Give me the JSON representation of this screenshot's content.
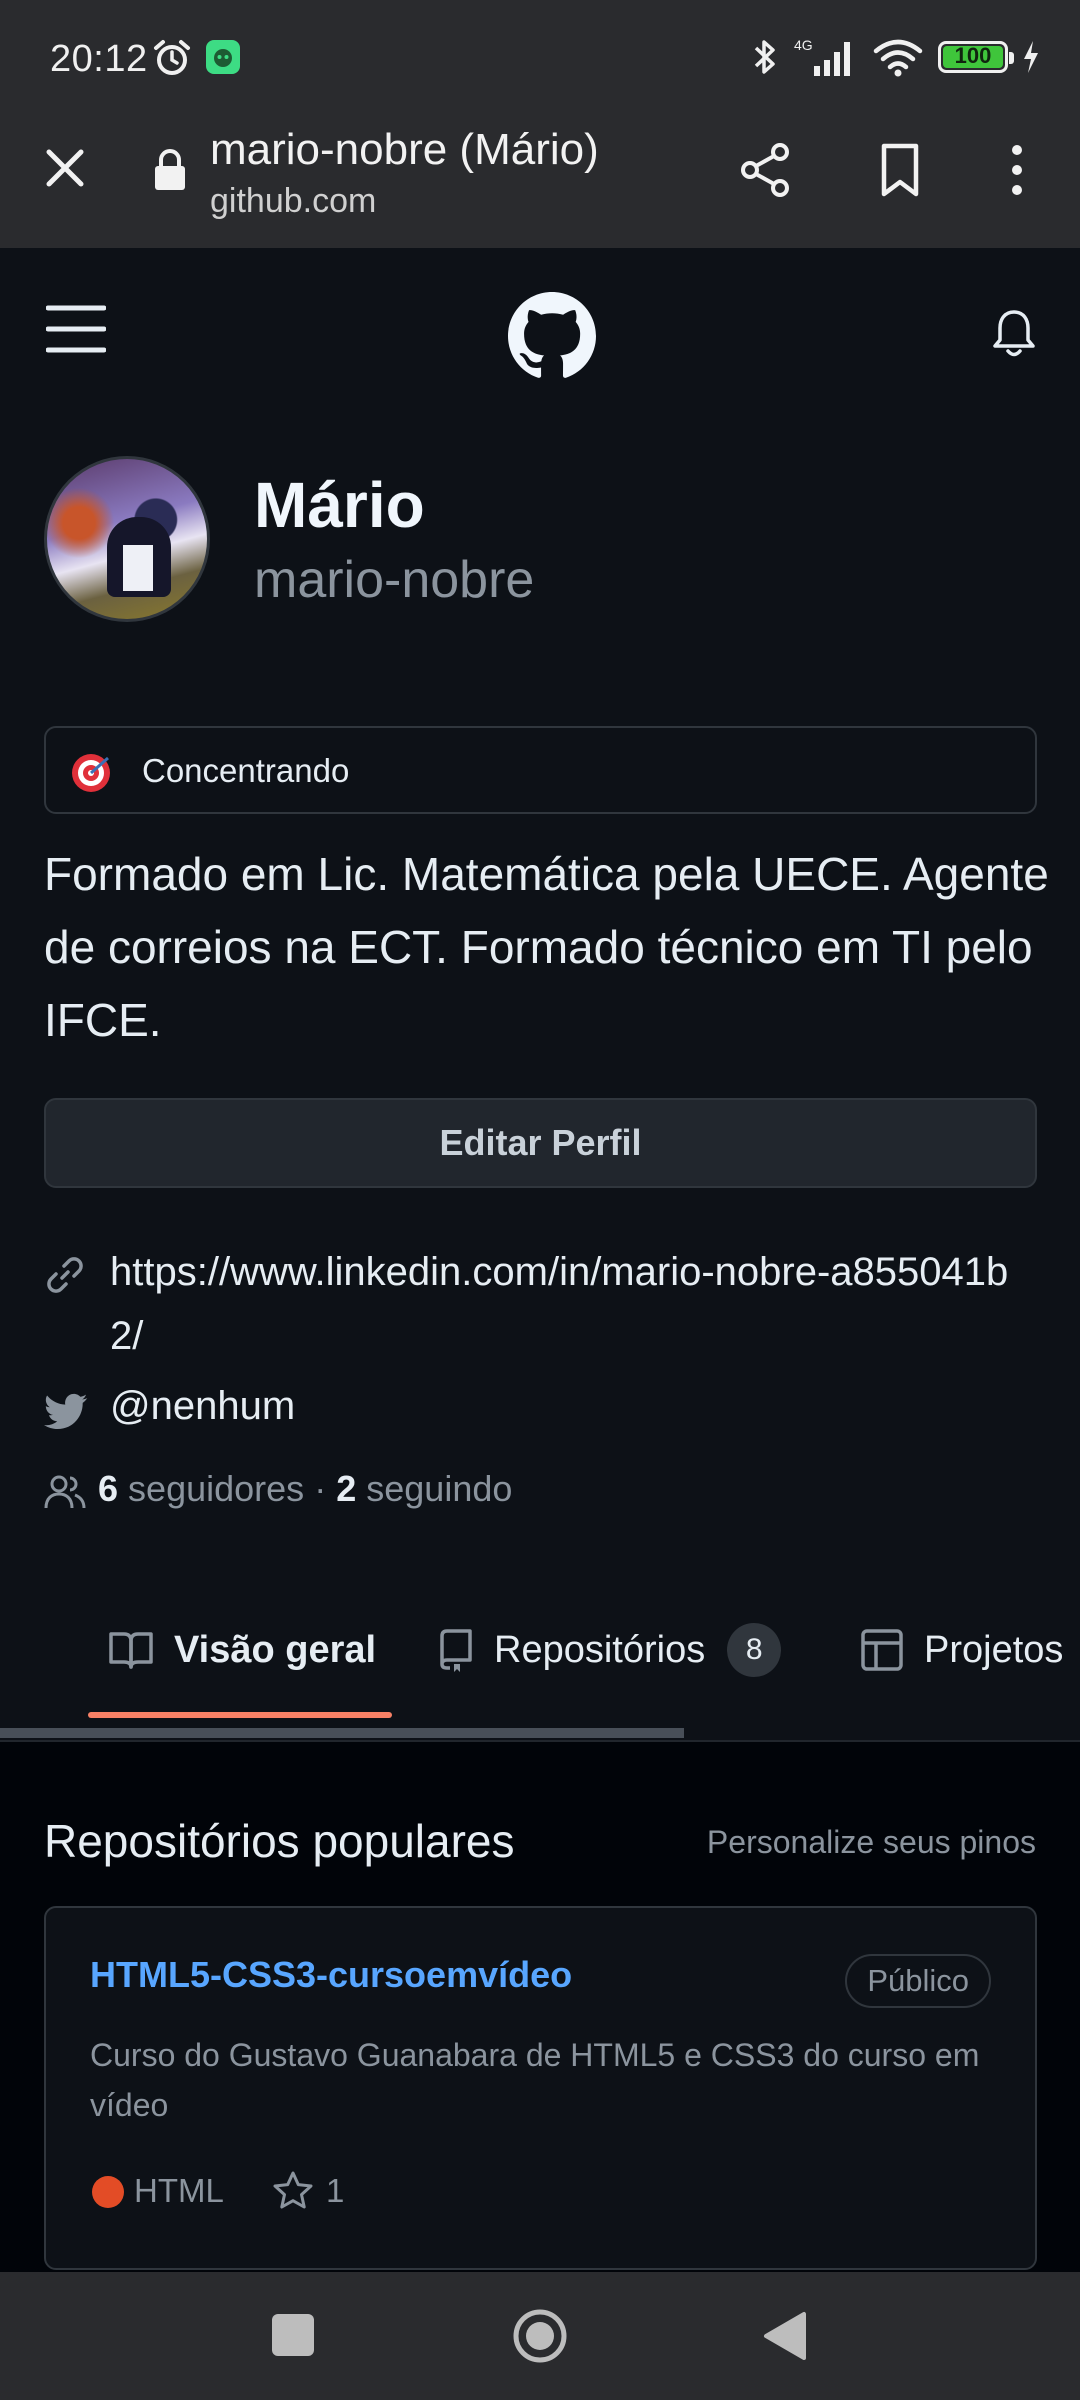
{
  "status_bar": {
    "time": "20:12",
    "network": "4G",
    "battery": "100",
    "icons": [
      "alarm-icon",
      "app-notification-icon",
      "bluetooth-icon",
      "signal-icon",
      "wifi-icon",
      "battery-icon",
      "charging-icon"
    ]
  },
  "browser": {
    "page_title": "mario-nobre (Mário)",
    "domain": "github.com",
    "icons": [
      "close-icon",
      "lock-icon",
      "share-icon",
      "bookmark-icon",
      "more-icon"
    ]
  },
  "profile": {
    "name": "Mário",
    "login": "mario-nobre",
    "status": "Concentrando",
    "bio": "Formado em Lic. Matemática pela UECE. Agente de correios na ECT. Formado técnico em TI pelo IFCE.",
    "edit_button": "Editar Perfil",
    "website": "https://www.linkedin.com/in/mario-nobre-a855041b2/",
    "twitter": "@nenhum",
    "followers_count": "6",
    "followers_label": "seguidores",
    "separator": "·",
    "following_count": "2",
    "following_label": "seguindo"
  },
  "tabs": [
    {
      "label": "Visão geral",
      "active": true
    },
    {
      "label": "Repositórios",
      "count": "8"
    },
    {
      "label": "Projetos"
    }
  ],
  "popular": {
    "title": "Repositórios populares",
    "customize_link": "Personalize seus pinos",
    "repos": [
      {
        "name": "HTML5-CSS3-cursoemvídeo",
        "visibility": "Público",
        "description": "Curso do Gustavo Guanabara de HTML5 e CSS3 do curso em vídeo",
        "language": "HTML",
        "language_color": "#e34c26",
        "stars": "1"
      }
    ]
  },
  "colors": {
    "background": "#0d1117",
    "accent_link": "#58a6ff",
    "tab_underline": "#f78166",
    "muted_text": "#8b949e"
  }
}
